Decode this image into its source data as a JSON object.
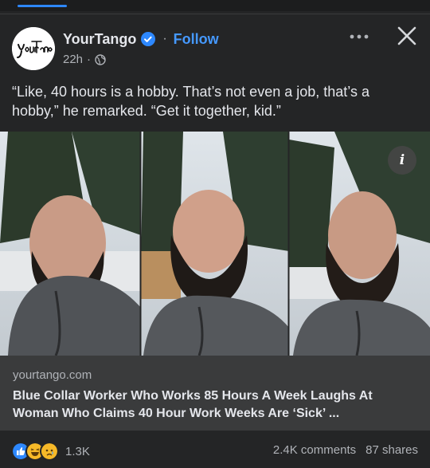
{
  "post": {
    "page_name": "YourTango",
    "follow_label": "Follow",
    "separator": "·",
    "timestamp": "22h",
    "time_separator": "·",
    "caption": "“Like, 40 hours is a hobby. That’s not even a job, that’s a hobby,” he remarked. “Get it together, kid.”",
    "avatar_logo_text": "YourTango"
  },
  "icons": {
    "verified": "verified-badge-icon",
    "globe": "globe-icon",
    "more": "more-options-icon",
    "close": "close-icon",
    "info": "info-icon",
    "info_glyph": "i"
  },
  "link_preview": {
    "domain": "yourtango.com",
    "headline": "Blue Collar Worker Who Works 85 Hours A Week Laughs At Woman Who Claims 40 Hour Work Weeks Are ‘Sick’ ..."
  },
  "engagement": {
    "reaction_icons": [
      "like-reaction-icon",
      "haha-reaction-icon",
      "sad-reaction-icon"
    ],
    "reaction_count": "1.3K",
    "comments": "2.4K comments",
    "shares": "87 shares"
  },
  "colors": {
    "background": "#242526",
    "link_box": "#3a3b3c",
    "accent": "#4599ff",
    "like": "#2d88ff",
    "haha": "#f7b928",
    "sad": "#f7b928",
    "text_primary": "#e4e6eb",
    "text_secondary": "#b0b3b8"
  }
}
